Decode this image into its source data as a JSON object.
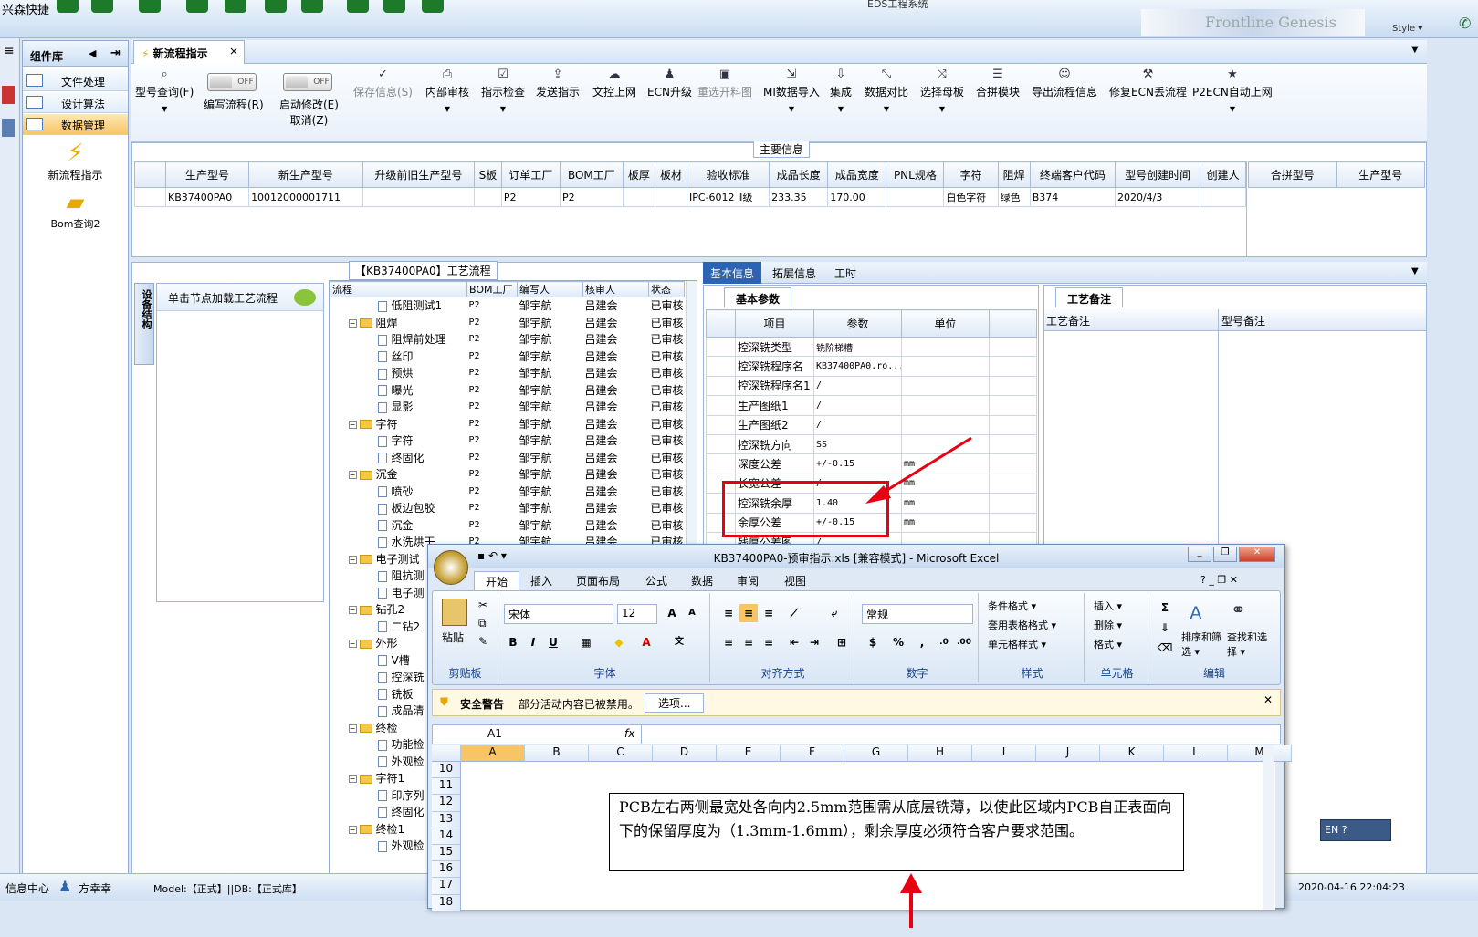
{
  "app": {
    "name": "兴森快捷",
    "window_title": "EDS工程系统",
    "logo_text": "Frontline  Genesis 2000",
    "style_label": "Style ▾"
  },
  "component_panel": {
    "title": "组件库",
    "items": [
      {
        "label": "文件处理"
      },
      {
        "label": "设计算法"
      },
      {
        "label": "数据管理",
        "active": true
      }
    ],
    "shortcuts": [
      {
        "label": "新流程指示",
        "icon": "lightning-icon"
      },
      {
        "label": "Bom查询2",
        "icon": "folder-icon"
      }
    ]
  },
  "doc_tab": {
    "label": "新流程指示",
    "close": "×"
  },
  "ribbon": {
    "buttons": [
      {
        "label": "型号查询(F)",
        "icon": "search-icon"
      },
      {
        "label": "编写流程(R)",
        "toggle": "OFF"
      },
      {
        "label": "启动修改(E)",
        "label2": "取消(Z)",
        "toggle": "OFF"
      },
      {
        "label": "保存信息(S)",
        "icon": "check-icon",
        "disabled": true
      },
      {
        "label": "内部审核",
        "icon": "print-icon"
      },
      {
        "label": "指示检查",
        "icon": "checkbox-icon"
      },
      {
        "label": "发送指示",
        "icon": "upload-icon"
      },
      {
        "label": "文控上网",
        "icon": "cloud-icon"
      },
      {
        "label": "ECN升级",
        "icon": "people-icon"
      },
      {
        "label": "重选开料图",
        "icon": "image-icon",
        "disabled": true
      },
      {
        "label": "MI数据导入",
        "icon": "import-icon"
      },
      {
        "label": "集成",
        "icon": "download-icon"
      },
      {
        "label": "数据对比",
        "icon": "compare-icon"
      },
      {
        "label": "选择母板",
        "icon": "shuffle-icon"
      },
      {
        "label": "合拼模块",
        "icon": "list-icon"
      },
      {
        "label": "导出流程信息",
        "icon": "smile-icon"
      },
      {
        "label": "修复ECN丢流程",
        "icon": "wrench-icon"
      },
      {
        "label": "P2ECN自动上网",
        "icon": "star-icon"
      }
    ]
  },
  "main_info": {
    "section_label": "主要信息",
    "columns": [
      "生产型号",
      "新生产型号",
      "升级前旧生产型号",
      "S板",
      "订单工厂",
      "BOM工厂",
      "板厚",
      "板材",
      "验收标准",
      "成品长度",
      "成品宽度",
      "PNL规格",
      "字符",
      "阻焊",
      "终端客户代码",
      "型号创建时间",
      "创建人"
    ],
    "rows": [
      [
        "KB37400PA0",
        "10012000001711",
        "",
        "",
        "P2",
        "P2",
        "",
        "",
        "IPC-6012 Ⅱ级",
        "233.35",
        "170.00",
        "",
        "白色字符",
        "绿色",
        "B374",
        "2020/4/3",
        ""
      ]
    ],
    "merge_columns": [
      "合拼型号",
      "生产型号"
    ]
  },
  "left_lower": {
    "side_tab": "设备结构",
    "hint": "单击节点加载工艺流程"
  },
  "process": {
    "label": "【KB37400PA0】工艺流程",
    "columns": [
      "流程",
      "BOM工厂",
      "编写人",
      "核审人",
      "状态"
    ],
    "rows": [
      {
        "name": "低阻测试1",
        "type": "doc",
        "bom": "P2",
        "writer": "邹宇航",
        "reviewer": "吕建会",
        "status": "已审核"
      },
      {
        "name": "阻焊",
        "type": "folder",
        "bom": "P2",
        "writer": "邹宇航",
        "reviewer": "吕建会",
        "status": "已审核"
      },
      {
        "name": "阻焊前处理",
        "type": "doc",
        "bom": "P2",
        "writer": "邹宇航",
        "reviewer": "吕建会",
        "status": "已审核"
      },
      {
        "name": "丝印",
        "type": "doc",
        "bom": "P2",
        "writer": "邹宇航",
        "reviewer": "吕建会",
        "status": "已审核"
      },
      {
        "name": "预烘",
        "type": "doc",
        "bom": "P2",
        "writer": "邹宇航",
        "reviewer": "吕建会",
        "status": "已审核"
      },
      {
        "name": "曝光",
        "type": "doc",
        "bom": "P2",
        "writer": "邹宇航",
        "reviewer": "吕建会",
        "status": "已审核"
      },
      {
        "name": "显影",
        "type": "doc",
        "bom": "P2",
        "writer": "邹宇航",
        "reviewer": "吕建会",
        "status": "已审核"
      },
      {
        "name": "字符",
        "type": "folder",
        "bom": "P2",
        "writer": "邹宇航",
        "reviewer": "吕建会",
        "status": "已审核"
      },
      {
        "name": "字符",
        "type": "doc",
        "bom": "P2",
        "writer": "邹宇航",
        "reviewer": "吕建会",
        "status": "已审核"
      },
      {
        "name": "终固化",
        "type": "doc",
        "bom": "P2",
        "writer": "邹宇航",
        "reviewer": "吕建会",
        "status": "已审核"
      },
      {
        "name": "沉金",
        "type": "folder",
        "bom": "P2",
        "writer": "邹宇航",
        "reviewer": "吕建会",
        "status": "已审核"
      },
      {
        "name": "喷砂",
        "type": "doc",
        "bom": "P2",
        "writer": "邹宇航",
        "reviewer": "吕建会",
        "status": "已审核"
      },
      {
        "name": "板边包胶",
        "type": "doc",
        "bom": "P2",
        "writer": "邹宇航",
        "reviewer": "吕建会",
        "status": "已审核"
      },
      {
        "name": "沉金",
        "type": "doc",
        "bom": "P2",
        "writer": "邹宇航",
        "reviewer": "吕建会",
        "status": "已审核"
      },
      {
        "name": "水洗烘干",
        "type": "doc",
        "bom": "P2",
        "writer": "邹宇航",
        "reviewer": "吕建会",
        "status": "已审核"
      },
      {
        "name": "电子测试",
        "type": "folder",
        "bom": "",
        "writer": "",
        "reviewer": "",
        "status": ""
      },
      {
        "name": "阻抗测",
        "type": "doc",
        "bom": "",
        "writer": "",
        "reviewer": "",
        "status": ""
      },
      {
        "name": "电子测",
        "type": "doc",
        "bom": "",
        "writer": "",
        "reviewer": "",
        "status": ""
      },
      {
        "name": "钻孔2",
        "type": "folder",
        "bom": "",
        "writer": "",
        "reviewer": "",
        "status": ""
      },
      {
        "name": "二钻2",
        "type": "doc",
        "bom": "",
        "writer": "",
        "reviewer": "",
        "status": ""
      },
      {
        "name": "外形",
        "type": "folder",
        "bom": "",
        "writer": "",
        "reviewer": "",
        "status": ""
      },
      {
        "name": "V槽",
        "type": "doc",
        "bom": "",
        "writer": "",
        "reviewer": "",
        "status": ""
      },
      {
        "name": "控深铣",
        "type": "doc",
        "bom": "",
        "writer": "",
        "reviewer": "",
        "status": ""
      },
      {
        "name": "铣板",
        "type": "doc",
        "bom": "",
        "writer": "",
        "reviewer": "",
        "status": ""
      },
      {
        "name": "成品清",
        "type": "doc",
        "bom": "",
        "writer": "",
        "reviewer": "",
        "status": ""
      },
      {
        "name": "终检",
        "type": "folder",
        "bom": "",
        "writer": "",
        "reviewer": "",
        "status": ""
      },
      {
        "name": "功能检",
        "type": "doc",
        "bom": "",
        "writer": "",
        "reviewer": "",
        "status": ""
      },
      {
        "name": "外观检",
        "type": "doc",
        "bom": "",
        "writer": "",
        "reviewer": "",
        "status": ""
      },
      {
        "name": "字符1",
        "type": "folder",
        "bom": "",
        "writer": "",
        "reviewer": "",
        "status": ""
      },
      {
        "name": "印序列",
        "type": "doc",
        "bom": "",
        "writer": "",
        "reviewer": "",
        "status": ""
      },
      {
        "name": "终固化",
        "type": "doc",
        "bom": "",
        "writer": "",
        "reviewer": "",
        "status": ""
      },
      {
        "name": "终检1",
        "type": "folder",
        "bom": "",
        "writer": "",
        "reviewer": "",
        "status": ""
      },
      {
        "name": "外观检",
        "type": "doc",
        "bom": "",
        "writer": "",
        "reviewer": "",
        "status": ""
      }
    ]
  },
  "info_tabs": [
    "基本信息",
    "拓展信息",
    "工时"
  ],
  "params": {
    "subtab": "基本参数",
    "columns": [
      "项目",
      "参数",
      "单位"
    ],
    "rows": [
      [
        "控深铣类型",
        "铣阶梯槽",
        ""
      ],
      [
        "控深铣程序名",
        "KB37400PA0.ro...",
        ""
      ],
      [
        "控深铣程序名1",
        "/",
        ""
      ],
      [
        "生产图纸1",
        "/",
        ""
      ],
      [
        "生产图纸2",
        "/",
        ""
      ],
      [
        "控深铣方向",
        "SS",
        ""
      ],
      [
        "深度公差",
        "+/-0.15",
        "mm"
      ],
      [
        "长宽公差",
        "/",
        "mm"
      ],
      [
        "控深铣余厚",
        "1.40",
        "mm"
      ],
      [
        "余厚公差",
        "+/-0.15",
        "mm"
      ],
      [
        "残厚公差图",
        "/",
        ""
      ]
    ]
  },
  "notes": {
    "subtab": "工艺备注",
    "columns": [
      "工艺备注",
      "型号备注"
    ]
  },
  "status": {
    "info_center": "信息中心",
    "user": "方幸幸",
    "model": "Model:【正式】||DB:【正式库】",
    "datetime": "2020-04-16 22:04:23"
  },
  "excel": {
    "title": "KB37400PA0-预审指示.xls  [兼容模式] - Microsoft Excel",
    "tabs": [
      "开始",
      "插入",
      "页面布局",
      "公式",
      "数据",
      "审阅",
      "视图"
    ],
    "groups": {
      "clipboard": "剪贴板",
      "font": "字体",
      "align": "对齐方式",
      "number": "数字",
      "styles": "样式",
      "cells": "单元格",
      "edit": "编辑"
    },
    "paste": "粘贴",
    "font_name": "宋体",
    "font_size": "12",
    "number_format": "常规",
    "style_items": [
      "条件格式 ▾",
      "套用表格格式 ▾",
      "单元格样式 ▾"
    ],
    "cell_items": [
      "插入 ▾",
      "删除 ▾",
      "格式 ▾"
    ],
    "edit_items": [
      "排序和筛选 ▾",
      "查找和选择 ▾"
    ],
    "security_label": "安全警告",
    "security_text": "部分活动内容已被禁用。",
    "options_button": "选项...",
    "name_box": "A1",
    "fx": "fx",
    "columns": [
      "A",
      "B",
      "C",
      "D",
      "E",
      "F",
      "G",
      "H",
      "I",
      "J",
      "K",
      "L",
      "M"
    ],
    "rows": [
      "10",
      "11",
      "12",
      "13",
      "14",
      "15",
      "16",
      "17",
      "18"
    ],
    "note": "PCB左右两侧最宽处各向内2.5mm范围需从底层铣薄，以使此区域内PCB自正表面向下的保留厚度为（1.3mm-1.6mm），剩余厚度必须符合客户要求范围。"
  },
  "ime": "EN",
  "colors": {
    "accent": "#2c64b4",
    "annotation_red": "#e60012"
  }
}
